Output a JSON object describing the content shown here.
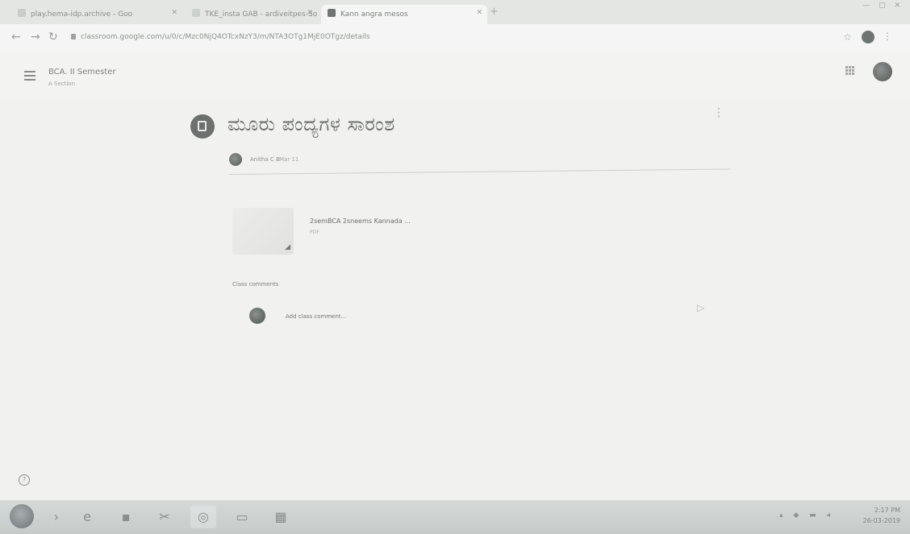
{
  "browser": {
    "tabs": [
      {
        "label": "play.hema-idp.archive - Goo",
        "active": false
      },
      {
        "label": "TKE_insta GAB - ardiveitpes-Soprs",
        "active": false
      },
      {
        "label": "Kann angra mesos",
        "active": true
      }
    ],
    "url": "classroom.google.com/u/0/c/Mzc0NjQ4OTcxNzY3/m/NTA3OTg1MjE0OTgz/details",
    "new_tab_glyph": "+",
    "accent_color": "#6c706e"
  },
  "header": {
    "class_name": "BCA. II Semester",
    "section": "A Section"
  },
  "post": {
    "title": "ಮೂರು ಪಂದ್ಯಗಳ ಸಾರಂಶ",
    "author": "Anitha C B",
    "date": "Mar 11",
    "attachment": {
      "name": "2semBCA 2sneems Kannada ...",
      "type": "PDF"
    }
  },
  "comments": {
    "label": "Class comments",
    "placeholder": "Add class comment..."
  },
  "taskbar": {
    "time": "2:17 PM",
    "date": "26-03-2019"
  },
  "icons": [
    "back-icon",
    "forward-icon",
    "reload-icon",
    "lock-icon",
    "star-icon",
    "hamburger-icon",
    "apps-icon",
    "assignment-icon",
    "more-vert-icon",
    "pdf-icon",
    "send-icon",
    "help-icon",
    "start-icon",
    "ie-icon",
    "chrome-icon",
    "explorer-icon"
  ]
}
